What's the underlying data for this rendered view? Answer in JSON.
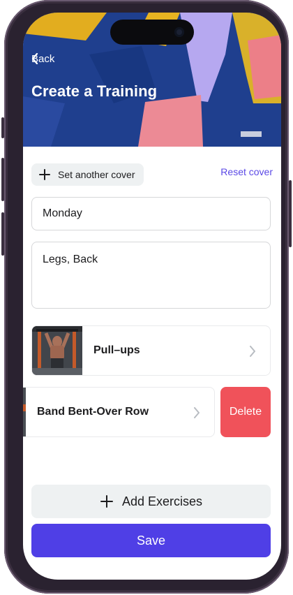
{
  "header": {
    "back_label": "Back",
    "title": "Create a Training"
  },
  "cover": {
    "set_label": "Set another cover",
    "reset_label": "Reset cover"
  },
  "form": {
    "name_value": "Monday",
    "tags_value": "Legs, Back"
  },
  "exercises": [
    {
      "name": "Pull–ups"
    },
    {
      "name": "Band Bent-Over Row"
    }
  ],
  "actions": {
    "delete_label": "Delete",
    "add_exercises_label": "Add Exercises",
    "save_label": "Save"
  },
  "colors": {
    "accent": "#4f3fe6",
    "link": "#5b49e6",
    "danger": "#f0525a",
    "secondary_bg": "#eef1f2"
  },
  "icons": {
    "back": "chevron-left-icon",
    "add": "plus-icon",
    "chevron": "chevron-right-icon"
  }
}
